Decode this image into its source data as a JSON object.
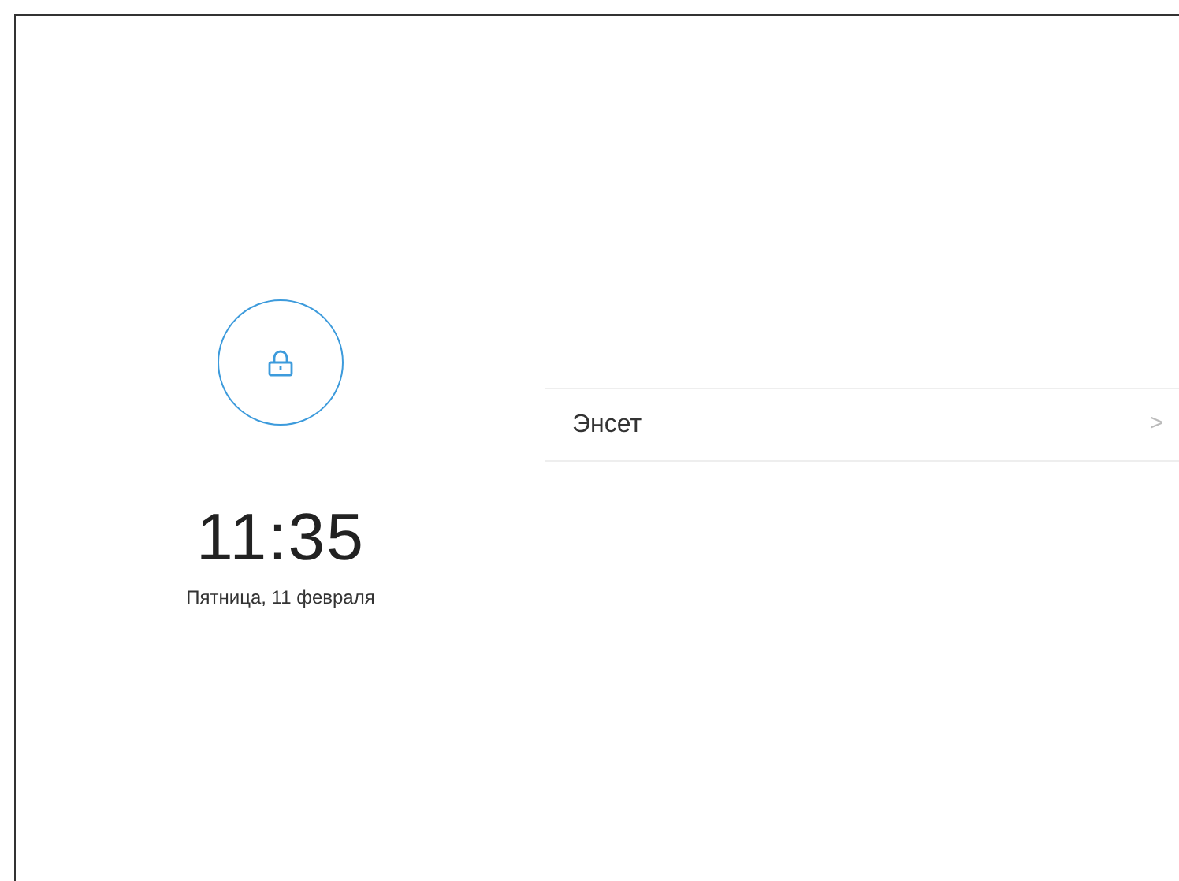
{
  "lock_screen": {
    "time": "11:35",
    "date": "Пятница, 11 февраля"
  },
  "accounts": [
    {
      "label": "Энсет",
      "chevron": ">"
    }
  ]
}
